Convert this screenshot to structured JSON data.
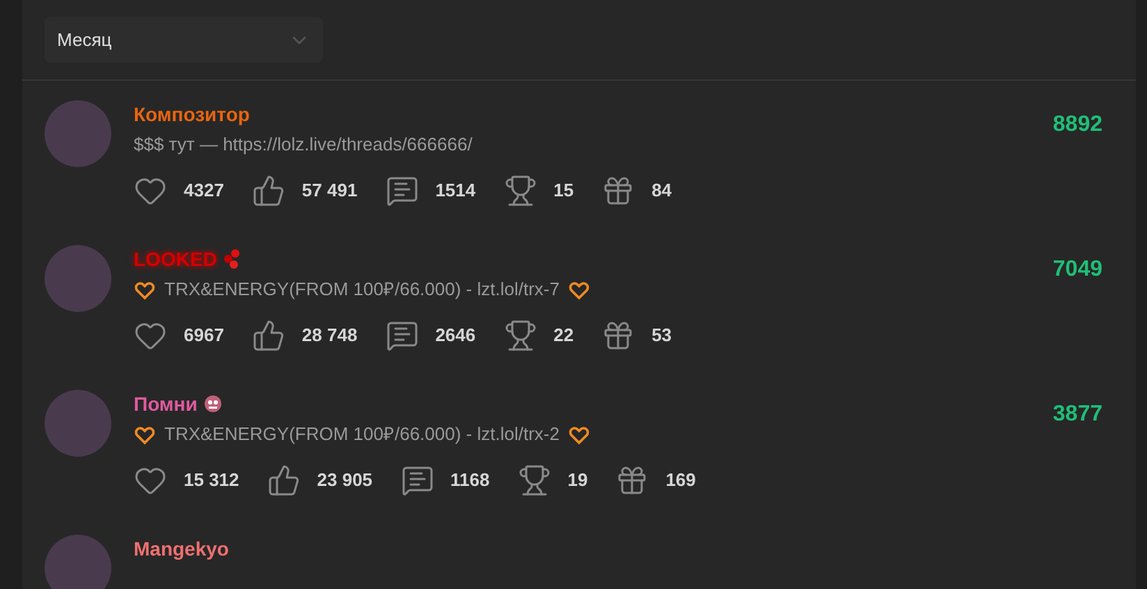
{
  "period_select": {
    "value": "Месяц"
  },
  "users": [
    {
      "name": "Композитор",
      "color": "#e8650f",
      "kind": "plain",
      "status": "$$$ тут — https://lolz.live/threads/666666/",
      "status_icons": false,
      "score": "8892",
      "stats": [
        "4327",
        "57 491",
        "1514",
        "15",
        "84"
      ]
    },
    {
      "name": "LOOKED",
      "color": "#d40000",
      "kind": "dots",
      "status": "TRX&ENERGY(FROM 100₽/66.000) - lzt.lol/trx-7",
      "status_icons": true,
      "score": "7049",
      "stats": [
        "6967",
        "28 748",
        "2646",
        "22",
        "53"
      ]
    },
    {
      "name": "Помни",
      "color": "#e05aa0",
      "kind": "face",
      "status": "TRX&ENERGY(FROM 100₽/66.000) - lzt.lol/trx-2",
      "status_icons": true,
      "score": "3877",
      "stats": [
        "15 312",
        "23 905",
        "1168",
        "19",
        "169"
      ]
    },
    {
      "name": "Mangekyo",
      "color": "#f07070",
      "kind": "plain"
    }
  ]
}
